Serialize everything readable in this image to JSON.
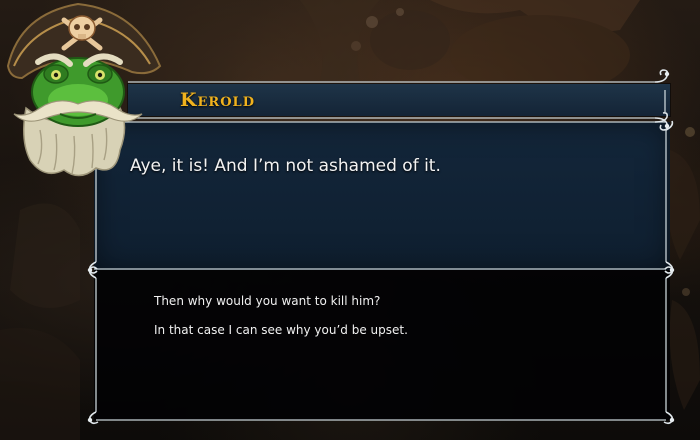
{
  "dialogue": {
    "speaker_name": "Kerold",
    "npc_line": "Aye, it is! And I’m not ashamed of it.",
    "choices": [
      {
        "label": "Then why would you want to kill him?"
      },
      {
        "label": "In that case I can see why you’d be upset."
      }
    ]
  },
  "portrait": {
    "depicts": "frog-pirate-captain",
    "icon": "skull-crossbones-icon"
  },
  "colors": {
    "speaker_name": "#f0b21e",
    "panel_blue": "#13263a",
    "frame": "#c8d2d6",
    "text": "#f3f3f3"
  }
}
